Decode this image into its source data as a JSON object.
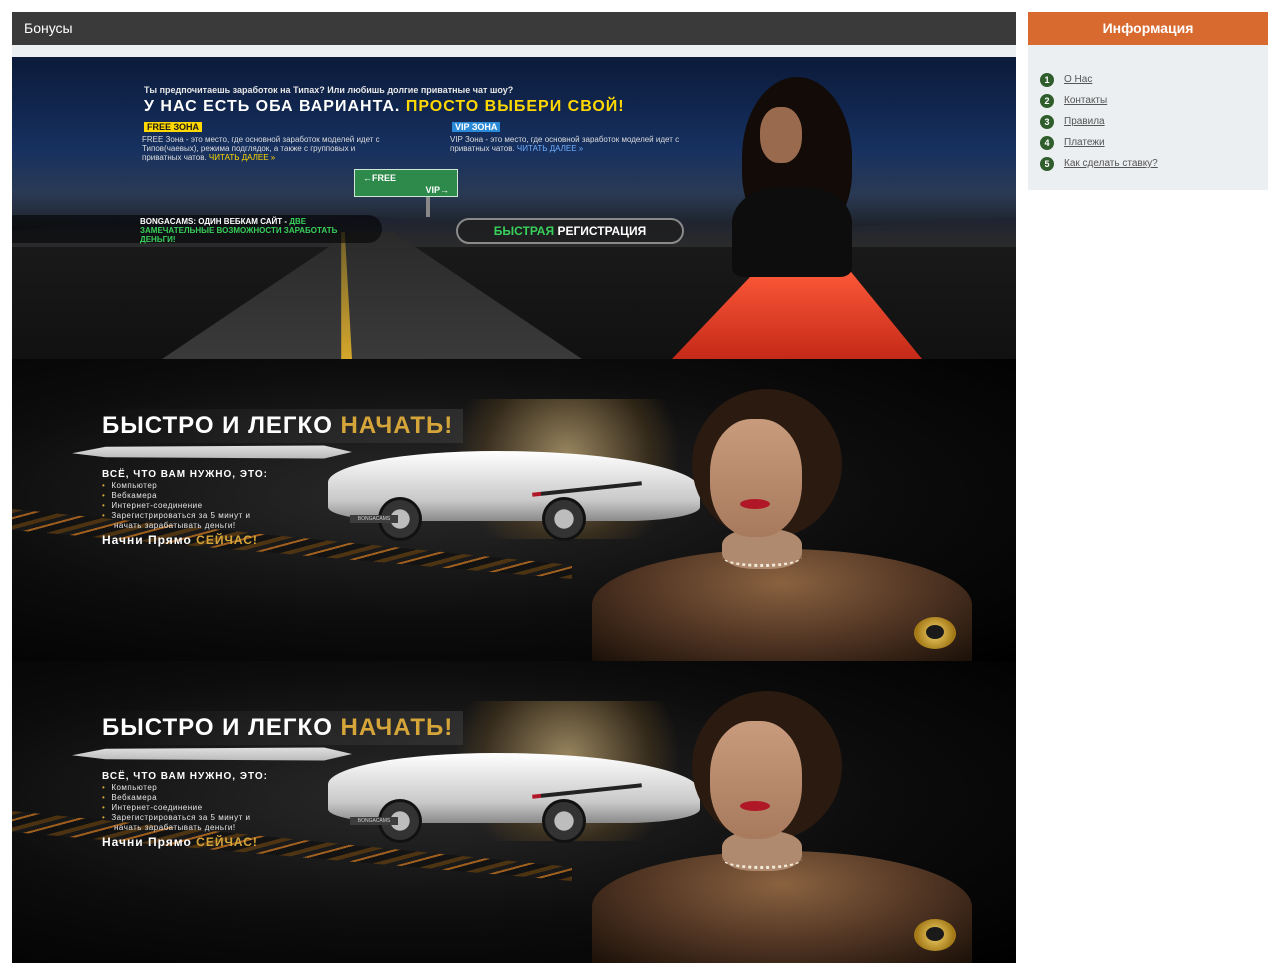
{
  "main": {
    "section_title": "Бонусы"
  },
  "banner1": {
    "question": "Ты предпочитаешь заработок на Типах? Или любишь долгие приватные чат шоу?",
    "headline_white": "У НАС ЕСТЬ ОБА ВАРИАНТА.",
    "headline_yellow": "ПРОСТО ВЫБЕРИ СВОЙ!",
    "free_tag": "FREE ЗОНА",
    "free_desc": "FREE Зона - это место, где основной заработок моделей идет с Типов(чаевых), режима подглядок, а также с групповых и приватных чатов.",
    "free_more": "ЧИТАТЬ ДАЛЕЕ »",
    "vip_tag": "VIP ЗОНА",
    "vip_desc": "VIP Зона - это место, где основной заработок моделей идет с приватных чатов.",
    "vip_more": "ЧИТАТЬ ДАЛЕЕ »",
    "sign_free": "←FREE",
    "sign_vip": "VIP→",
    "bottom_white": "BONGACAMS: ОДИН ВЕБКАМ САЙТ -",
    "bottom_green": "ДВЕ ЗАМЕЧАТЕЛЬНЫЕ ВОЗМОЖНОСТИ ЗАРАБОТАТЬ ДЕНЬГИ!",
    "reg_green": "БЫСТРАЯ",
    "reg_white": "РЕГИСТРАЦИЯ"
  },
  "banner2": {
    "headline_white": "БЫСТРО И ЛЕГКО",
    "headline_gold": "НАЧАТЬ!",
    "need_title": "ВСЁ, ЧТО ВАМ НУЖНО, ЭТО:",
    "items": [
      "Компьютер",
      "Вебкамера",
      "Интернет-соединение",
      "Зарегистрироваться за 5 минут и",
      "начать зарабатывать деньги!"
    ],
    "cta_white": "Начни Прямо",
    "cta_gold": "СЕЙЧАС!",
    "plate": "BONGACAMS"
  },
  "sidebar": {
    "title": "Информация",
    "items": [
      {
        "num": "1",
        "label": "О Нас"
      },
      {
        "num": "2",
        "label": "Контакты"
      },
      {
        "num": "3",
        "label": "Правила"
      },
      {
        "num": "4",
        "label": "Платежи"
      },
      {
        "num": "5",
        "label": "Как сделать ставку?"
      }
    ]
  },
  "colors": {
    "header_dark": "#3a3a3a",
    "sidebar_header_orange": "#d96a2f",
    "number_badge_green": "#2f5d2c",
    "sidebar_bg": "#eceff1"
  }
}
